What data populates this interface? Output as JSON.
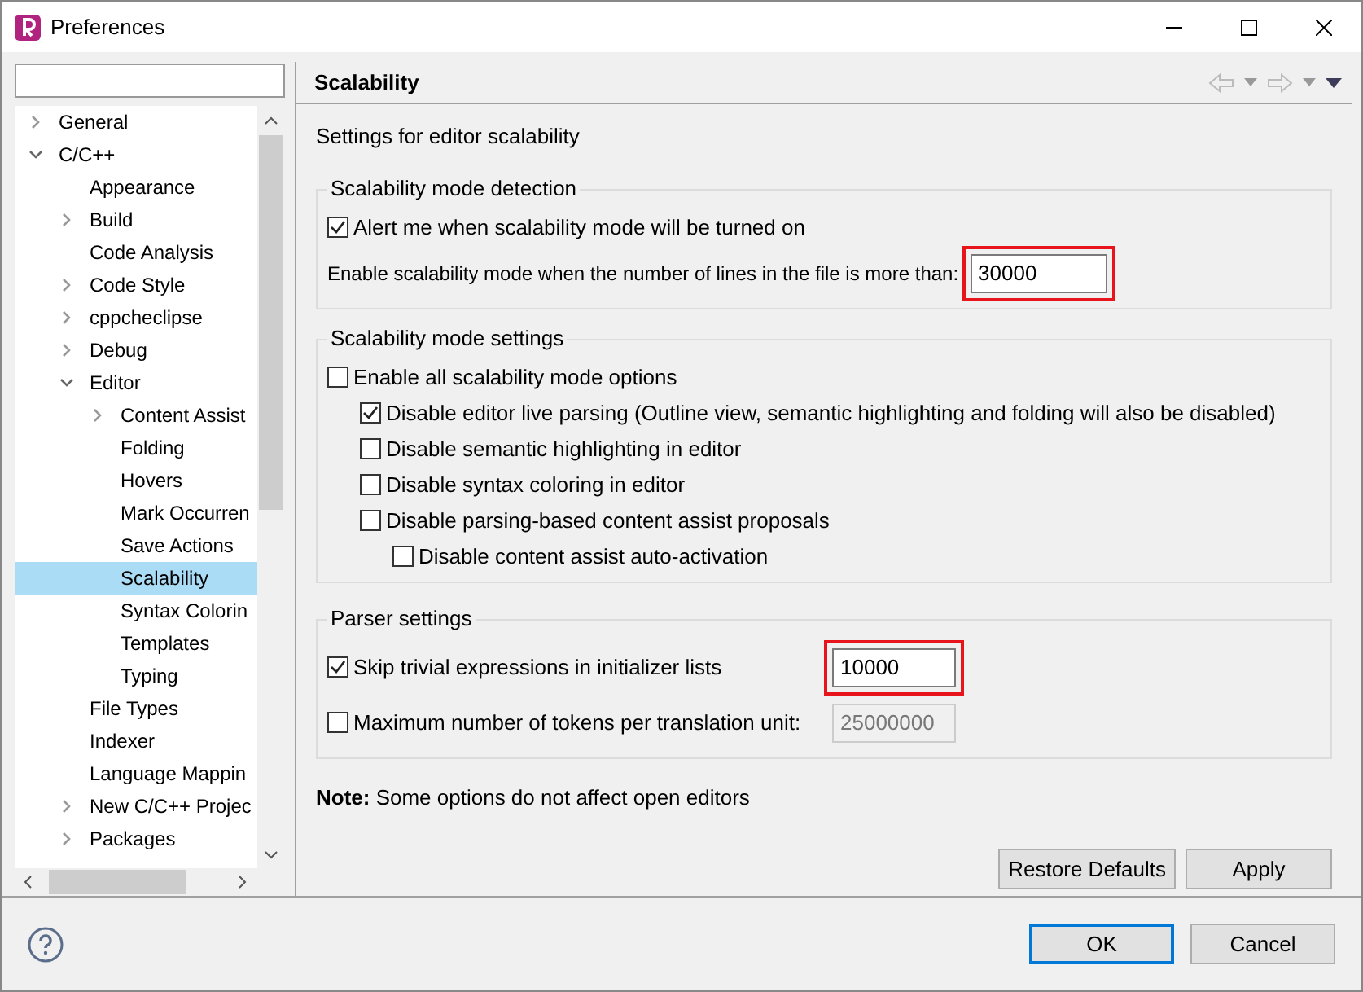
{
  "window": {
    "title": "Preferences"
  },
  "sidebar": {
    "tree": [
      {
        "label": "General",
        "expanded": false,
        "selected": false
      },
      {
        "label": "C/C++",
        "expanded": true,
        "selected": false,
        "children": [
          {
            "label": "Appearance",
            "selected": false
          },
          {
            "label": "Build",
            "expanded": false,
            "selected": false
          },
          {
            "label": "Code Analysis",
            "selected": false
          },
          {
            "label": "Code Style",
            "expanded": false,
            "selected": false
          },
          {
            "label": "cppcheclipse",
            "expanded": false,
            "selected": false
          },
          {
            "label": "Debug",
            "expanded": false,
            "selected": false
          },
          {
            "label": "Editor",
            "expanded": true,
            "selected": false,
            "children": [
              {
                "label": "Content Assist",
                "expanded": false,
                "selected": false
              },
              {
                "label": "Folding",
                "selected": false
              },
              {
                "label": "Hovers",
                "selected": false
              },
              {
                "label": "Mark Occurren",
                "selected": false
              },
              {
                "label": "Save Actions",
                "selected": false
              },
              {
                "label": "Scalability",
                "selected": true
              },
              {
                "label": "Syntax Colorin",
                "selected": false
              },
              {
                "label": "Templates",
                "selected": false
              },
              {
                "label": "Typing",
                "selected": false
              }
            ]
          },
          {
            "label": "File Types",
            "selected": false
          },
          {
            "label": "Indexer",
            "selected": false
          },
          {
            "label": "Language Mappin",
            "selected": false
          },
          {
            "label": "New C/C++ Projec",
            "expanded": false,
            "selected": false
          },
          {
            "label": "Packages",
            "expanded": false,
            "selected": false
          }
        ]
      }
    ]
  },
  "page": {
    "title": "Scalability",
    "description": "Settings for editor scalability",
    "detection": {
      "title": "Scalability mode detection",
      "alert": {
        "label": "Alert me when scalability mode will be turned on",
        "checked": true
      },
      "lines": {
        "label": "Enable scalability mode when the number of lines in the file is more than:",
        "value": "30000",
        "highlighted": true
      }
    },
    "mode_settings": {
      "title": "Scalability mode settings",
      "options": [
        {
          "label": "Enable all scalability mode options",
          "checked": false,
          "children": [
            {
              "label": "Disable editor live parsing (Outline view, semantic highlighting and folding will also be disabled)",
              "checked": true
            },
            {
              "label": "Disable semantic highlighting in editor",
              "checked": false
            },
            {
              "label": "Disable syntax coloring in editor",
              "checked": false
            },
            {
              "label": "Disable parsing-based content assist proposals",
              "checked": false,
              "children": [
                {
                  "label": "Disable content assist auto-activation",
                  "checked": false
                }
              ]
            }
          ]
        }
      ]
    },
    "parser": {
      "title": "Parser settings",
      "rows": [
        {
          "label": "Skip trivial expressions in initializer lists",
          "checked": true,
          "value": "10000",
          "disabled": false,
          "highlighted": true
        },
        {
          "label": "Maximum number of tokens per translation unit:",
          "checked": false,
          "value": "25000000",
          "disabled": true,
          "highlighted": false
        }
      ]
    },
    "note": "**Note:** Some options do not affect open editors",
    "buttons": [
      "Restore Defaults",
      "Apply"
    ]
  },
  "footer": {
    "buttons": [
      {
        "label": "OK",
        "default": true
      },
      {
        "label": "Cancel",
        "default": false
      }
    ]
  }
}
